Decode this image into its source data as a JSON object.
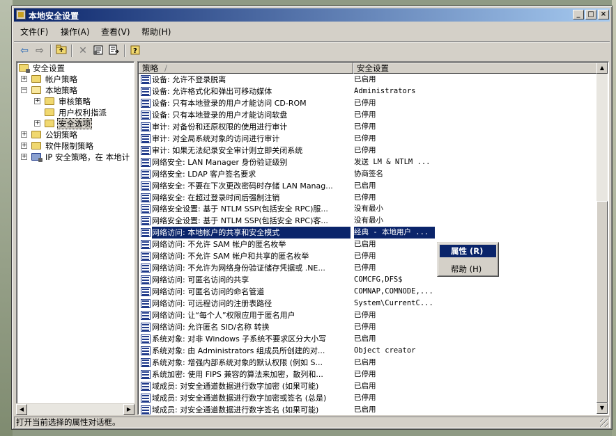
{
  "window": {
    "title": "本地安全设置",
    "controls": [
      "_",
      "□",
      "×"
    ]
  },
  "menubar": {
    "items": [
      "文件(F)",
      "操作(A)",
      "查看(V)",
      "帮助(H)"
    ]
  },
  "toolbar": {
    "icons": [
      "back-arrow-icon",
      "forward-arrow-icon",
      "up-folder-icon",
      "delete-icon",
      "properties-icon",
      "export-list-icon",
      "help-icon"
    ]
  },
  "tree": {
    "items": [
      {
        "label": "安全设置"
      },
      {
        "label": "帐户策略"
      },
      {
        "label": "本地策略"
      },
      {
        "label": "审核策略"
      },
      {
        "label": "用户权利指派"
      },
      {
        "label": "安全选项"
      },
      {
        "label": "公钥策略"
      },
      {
        "label": "软件限制策略"
      },
      {
        "label": "IP 安全策略，在 本地计"
      }
    ]
  },
  "list": {
    "columns": [
      "策略",
      "安全设置"
    ],
    "sort_indicator": "/",
    "rows": [
      {
        "name": "设备: 允许不登录脱离",
        "value": "已启用"
      },
      {
        "name": "设备: 允许格式化和弹出可移动媒体",
        "value": "Administrators"
      },
      {
        "name": "设备: 只有本地登录的用户才能访问 CD-ROM",
        "value": "已停用"
      },
      {
        "name": "设备: 只有本地登录的用户才能访问软盘",
        "value": "已停用"
      },
      {
        "name": "审计: 对备份和还原权限的使用进行审计",
        "value": "已停用"
      },
      {
        "name": "审计: 对全局系统对象的访问进行审计",
        "value": "已停用"
      },
      {
        "name": "审计: 如果无法纪录安全审计则立即关闭系统",
        "value": "已停用"
      },
      {
        "name": "网络安全: LAN Manager 身份验证级别",
        "value": "发送 LM & NTLM ..."
      },
      {
        "name": "网络安全: LDAP 客户签名要求",
        "value": "协商签名"
      },
      {
        "name": "网络安全: 不要在下次更改密码时存储 LAN Manag...",
        "value": "已启用"
      },
      {
        "name": "网络安全: 在超过登录时间后强制注销",
        "value": "已停用"
      },
      {
        "name": "网络安全设置: 基于 NTLM SSP(包括安全 RPC)服...",
        "value": "没有最小"
      },
      {
        "name": "网络安全设置: 基于 NTLM SSP(包括安全 RPC)客...",
        "value": "没有最小"
      },
      {
        "name": "网络访问: 本地帐户的共享和安全模式",
        "value": "经典 - 本地用户 ..."
      },
      {
        "name": "网络访问: 不允许 SAM 帐户的匿名枚举",
        "value": "已启用"
      },
      {
        "name": "网络访问: 不允许 SAM 帐户和共享的匿名枚举",
        "value": "已停用"
      },
      {
        "name": "网络访问: 不允许为网络身份验证储存凭据或 .NE...",
        "value": "已停用"
      },
      {
        "name": "网络访问: 可匿名访问的共享",
        "value": "COMCFG,DFS$"
      },
      {
        "name": "网络访问: 可匿名访问的命名管道",
        "value": "COMNAP,COMNODE,..."
      },
      {
        "name": "网络访问: 可远程访问的注册表路径",
        "value": "System\\CurrentC..."
      },
      {
        "name": "网络访问: 让“每个人”权限应用于匿名用户",
        "value": "已停用"
      },
      {
        "name": "网络访问: 允许匿名 SID/名称 转换",
        "value": "已停用"
      },
      {
        "name": "系统对象: 对非 Windows 子系统不要求区分大小写",
        "value": "已启用"
      },
      {
        "name": "系统对象: 由 Administrators 组成员所创建的对...",
        "value": "Object creator"
      },
      {
        "name": "系统对象: 增强内部系统对象的默认权限 (例如 S...",
        "value": "已启用"
      },
      {
        "name": "系统加密: 使用 FIPS 兼容的算法来加密，散列和...",
        "value": "已停用"
      },
      {
        "name": "域成员: 对安全通道数据进行数字加密 (如果可能)",
        "value": "已启用"
      },
      {
        "name": "域成员: 对安全通道数据进行数字加密或签名 (总是)",
        "value": "已停用"
      },
      {
        "name": "域成员: 对安全通道数据进行数字签名 (如果可能)",
        "value": "已启用"
      }
    ]
  },
  "context_menu": {
    "items": [
      "属性 (R)",
      "帮助 (H)"
    ]
  },
  "statusbar": {
    "text": "打开当前选择的属性对话框。"
  },
  "colors": {
    "titlebar_start": "#0a246a",
    "titlebar_end": "#a6caf0",
    "selection": "#0a246a",
    "chrome": "#d4d0c8"
  }
}
